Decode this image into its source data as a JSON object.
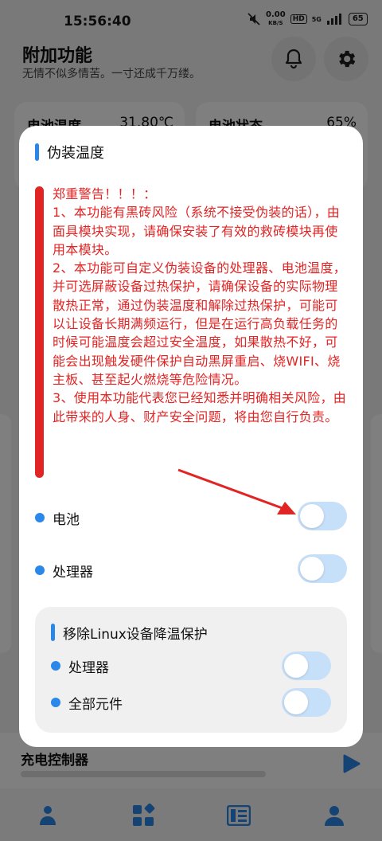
{
  "status_bar": {
    "time": "15:56:40",
    "net_speed_value": "0.00",
    "net_speed_unit": "KB/S",
    "hd": "HD",
    "signal": "5G",
    "battery": "65"
  },
  "header": {
    "title": "附加功能",
    "subtitle": "无情不似多情苦。一寸还成千万缕。"
  },
  "background_cards": {
    "temp_label": "电池温度",
    "temp_value": "31.80℃",
    "status_label": "电池状态",
    "status_value": "65%",
    "charge_label": "充电控制器"
  },
  "dialog": {
    "title": "伪装温度",
    "warning_lines": [
      "郑重警告！！！：",
      "1、本功能有黑砖风险（系统不接受伪装的话），由面具模块实现，请确保安装了有效的救砖模块再使用本模块。",
      "2、本功能可自定义伪装设备的处理器、电池温度，并可选屏蔽设备过热保护，请确保设备的实际物理散热正常，通过伪装温度和解除过热保护，可能可以让设备长期满频运行，但是在运行高负载任务的时候可能温度会超过安全温度，如果散热不好，可能会出现触发硬件保护自动黑屏重启、烧WIFI、烧主板、甚至起火燃烧等危险情况。",
      "3、使用本功能代表您已经知悉并明确相关风险，由此带来的人身、财产安全问题，将由您自行负责。"
    ],
    "options": [
      {
        "label": "电池",
        "enabled": false
      },
      {
        "label": "处理器",
        "enabled": false
      }
    ],
    "linux_panel": {
      "title": "移除Linux设备降温保护",
      "options": [
        {
          "label": "处理器",
          "enabled": false
        },
        {
          "label": "全部元件",
          "enabled": false
        }
      ]
    }
  },
  "colors": {
    "accent": "#2b88e8",
    "warning": "#e12424",
    "toggle_off_track": "#c7e0f9"
  },
  "icons": {
    "bell": "bell-icon",
    "gear": "gear-icon",
    "play": "play-icon",
    "nav": [
      "person-icon",
      "apps-icon",
      "list-icon",
      "account-icon"
    ]
  }
}
